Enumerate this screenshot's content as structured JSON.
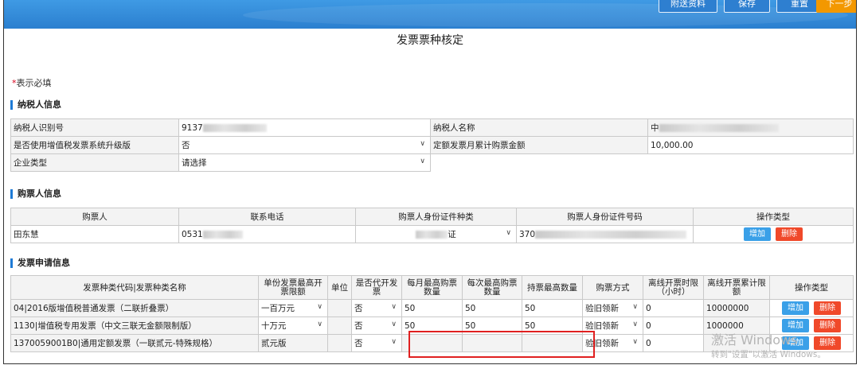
{
  "toolbar": {
    "buttons": [
      "附送资料",
      "保存",
      "重置",
      "下一步"
    ]
  },
  "page_title": "发票票种核定",
  "required_note": {
    "star": "*",
    "text": "表示必填"
  },
  "taxpayer": {
    "section_title": "纳税人信息",
    "id_label": "纳税人识别号",
    "id_value": "9137",
    "name_label": "纳税人名称",
    "name_value": "中",
    "upgrade_label": "是否使用增值税发票系统升级版",
    "upgrade_value": "否",
    "monthly_limit_label": "定额发票月累计购票金额",
    "monthly_limit_value": "10,000.00",
    "enterprise_type_label": "企业类型",
    "enterprise_type_value": "请选择"
  },
  "buyer": {
    "section_title": "购票人信息",
    "headers": [
      "购票人",
      "联系电话",
      "购票人身份证件种类",
      "购票人身份证件号码",
      "操作类型"
    ],
    "row": {
      "name": "田东慧",
      "phone": "0531",
      "id_type": "证",
      "id_number": "370"
    },
    "add_label": "增加",
    "delete_label": "删除"
  },
  "invoice": {
    "section_title": "发票申请信息",
    "headers": [
      "发票种类代码|发票种类名称",
      "单份发票最高开票限额",
      "单位",
      "是否代开发票",
      "每月最高购票数量",
      "每次最高购票数量",
      "持票最高数量",
      "购票方式",
      "离线开票时限（小时）",
      "离线开票累计限额",
      "操作类型"
    ],
    "rows": [
      {
        "code_name": "04|2016版增值税普通发票（二联折叠票）",
        "limit": "一百万元",
        "unit": "",
        "proxy": "否",
        "monthly": "50",
        "per_time": "50",
        "max_hold": "50",
        "method": "验旧领新",
        "offline_hours": "0",
        "offline_limit": "10000000"
      },
      {
        "code_name": "1130|增值税专用发票（中文三联无金额限制版）",
        "limit": "十万元",
        "unit": "",
        "proxy": "否",
        "monthly": "50",
        "per_time": "50",
        "max_hold": "50",
        "method": "验旧领新",
        "offline_hours": "0",
        "offline_limit": "1000000"
      },
      {
        "code_name": "1370059001B0|通用定额发票（一联贰元-特殊规格）",
        "limit": "贰元版",
        "unit": "",
        "proxy": "否",
        "monthly": "",
        "per_time": "",
        "max_hold": "",
        "method": "验旧领新",
        "offline_hours": "0",
        "offline_limit": ""
      }
    ],
    "add_label": "增加",
    "delete_label": "删除"
  },
  "watermark": {
    "line1": "激活 Windows",
    "line2": "转到\"设置\"以激活 Windows。"
  }
}
